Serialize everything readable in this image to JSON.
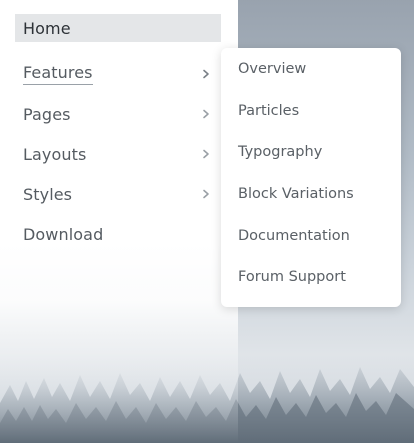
{
  "menu": {
    "items": [
      {
        "label": "Home",
        "state": "active"
      },
      {
        "label": "Features",
        "has_submenu": true,
        "state": "open"
      },
      {
        "label": "Pages",
        "has_submenu": true
      },
      {
        "label": "Layouts",
        "has_submenu": true
      },
      {
        "label": "Styles",
        "has_submenu": true
      },
      {
        "label": "Download"
      }
    ]
  },
  "submenu": {
    "parent": "Features",
    "items": [
      {
        "label": "Overview"
      },
      {
        "label": "Particles"
      },
      {
        "label": "Typography"
      },
      {
        "label": "Block Variations"
      },
      {
        "label": "Documentation"
      },
      {
        "label": "Forum Support"
      }
    ]
  },
  "icons": {
    "chevron": "chevron-right-icon"
  },
  "colors": {
    "active_bg": "#e4e6e8",
    "text": "#555b61",
    "submenu_bg": "#ffffff"
  }
}
